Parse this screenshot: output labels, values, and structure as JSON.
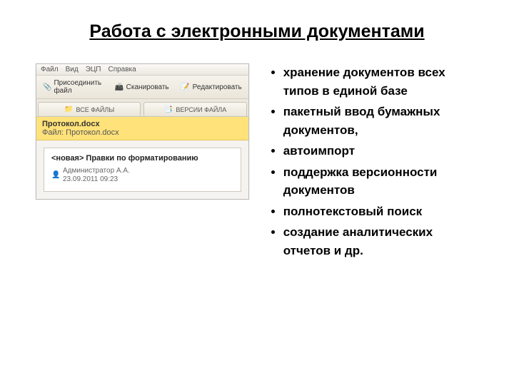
{
  "title": "Работа с электронными документами",
  "app": {
    "menu": [
      "Файл",
      "Вид",
      "ЭЦП",
      "Справка"
    ],
    "toolbar": [
      {
        "icon": "📎",
        "label": "Присоединить файл"
      },
      {
        "icon": "📠",
        "label": "Сканировать"
      },
      {
        "icon": "📝",
        "label": "Редактировать"
      }
    ],
    "tabs": [
      {
        "icon": "📁",
        "label": "ВСЕ ФАЙЛЫ"
      },
      {
        "icon": "📑",
        "label": "ВЕРСИИ ФАЙЛА"
      }
    ],
    "file": {
      "name": "Протокол.docx",
      "path_label": "Файл:",
      "path": "Протокол.docx"
    },
    "card": {
      "title": "<новая> Правки по форматированию",
      "user_icon": "👤",
      "user": "Администратор А.А.",
      "time_icon": "🕒",
      "time": "23.09.2011 09:23"
    }
  },
  "bullets": [
    "хранение документов всех типов в единой базе",
    "пакетный ввод бумажных документов,",
    "автоимпорт",
    "поддержка версионности документов",
    "полнотекстовый поиск",
    "создание аналитических отчетов и др."
  ]
}
